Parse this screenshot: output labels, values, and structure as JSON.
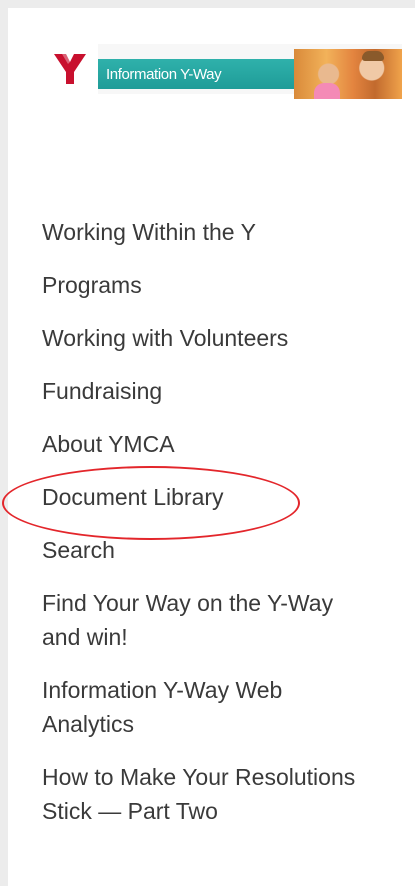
{
  "banner": {
    "logo_icon": "ymca-y-icon",
    "logo_color": "#c8102e",
    "strip_text": "Information Y-Way",
    "strip_color": "#2fb1ab",
    "photo": "children-photo"
  },
  "nav": {
    "items": [
      {
        "label": "Working Within the Y"
      },
      {
        "label": "Programs"
      },
      {
        "label": "Working with Volunteers"
      },
      {
        "label": "Fundraising"
      },
      {
        "label": "About YMCA"
      },
      {
        "label": "Document Library"
      },
      {
        "label": "Search"
      },
      {
        "label": "Find Your Way on the Y-Way and win!"
      },
      {
        "label": "Information Y-Way Web Analytics"
      },
      {
        "label": "How to Make Your Resolutions Stick — Part Two"
      }
    ],
    "highlighted_item": "Document Library",
    "highlight_color": "#e3262b"
  }
}
